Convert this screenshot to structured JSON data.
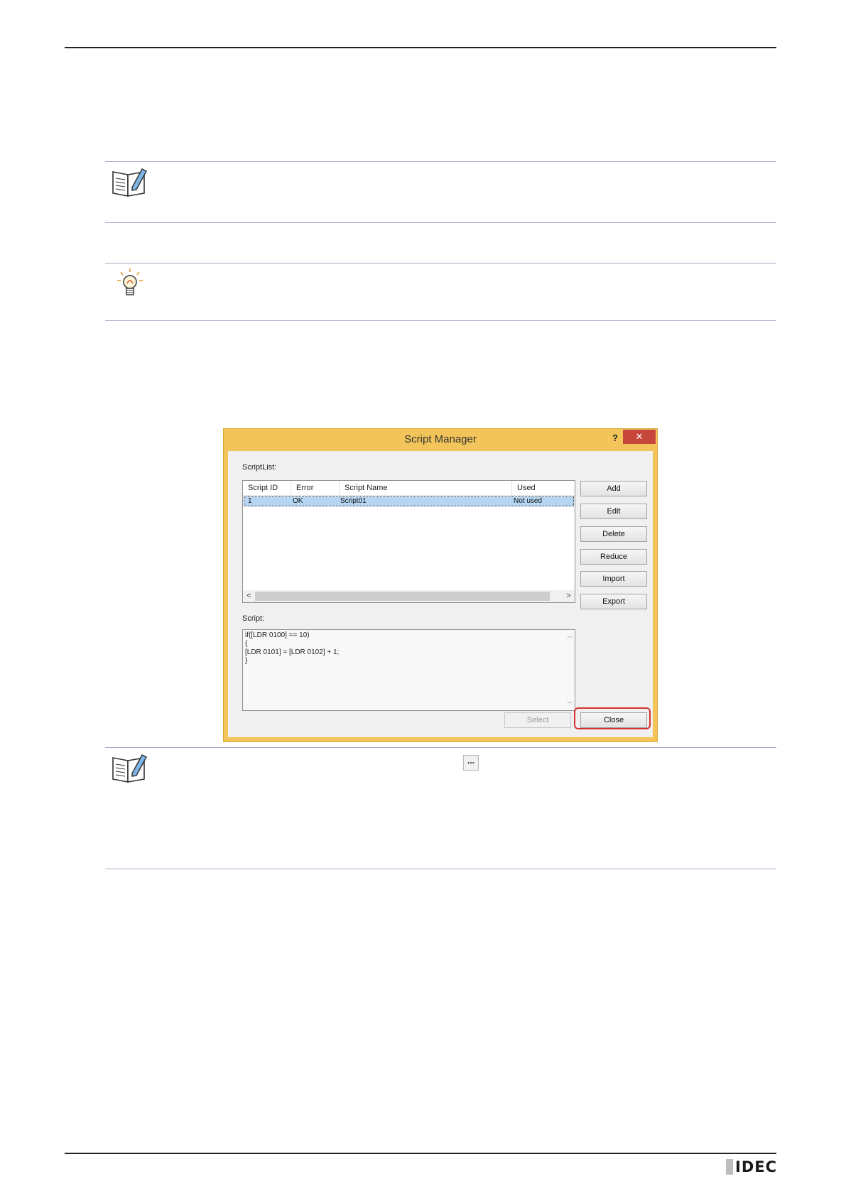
{
  "dialog": {
    "title": "Script Manager",
    "help_label": "?",
    "close_label": "✕",
    "script_list_label": "ScriptList:",
    "columns": [
      "Script ID",
      "Error",
      "Script Name",
      "Used"
    ],
    "rows": [
      {
        "script_id": "1",
        "error": "OK",
        "script_name": "Script01",
        "used": "Not used"
      }
    ],
    "scroll_left": "<",
    "scroll_right": ">",
    "buttons": {
      "add": "Add",
      "edit": "Edit",
      "delete": "Delete",
      "reduce": "Reduce",
      "import": "Import",
      "export": "Export",
      "select": "Select",
      "close": "Close"
    },
    "script_label": "Script:",
    "script_lines": [
      "if([LDR 0100] == 10)",
      "{",
      "[LDR 0101] = [LDR 0102] + 1;",
      "}"
    ]
  },
  "ellipsis_button": "...",
  "logo": {
    "text": "IDEC"
  },
  "colors": {
    "dialog_frame": "#f2c45a",
    "highlight": "#d6302f",
    "selected_row": "#b5d5f2",
    "close_button": "#c7463c"
  }
}
